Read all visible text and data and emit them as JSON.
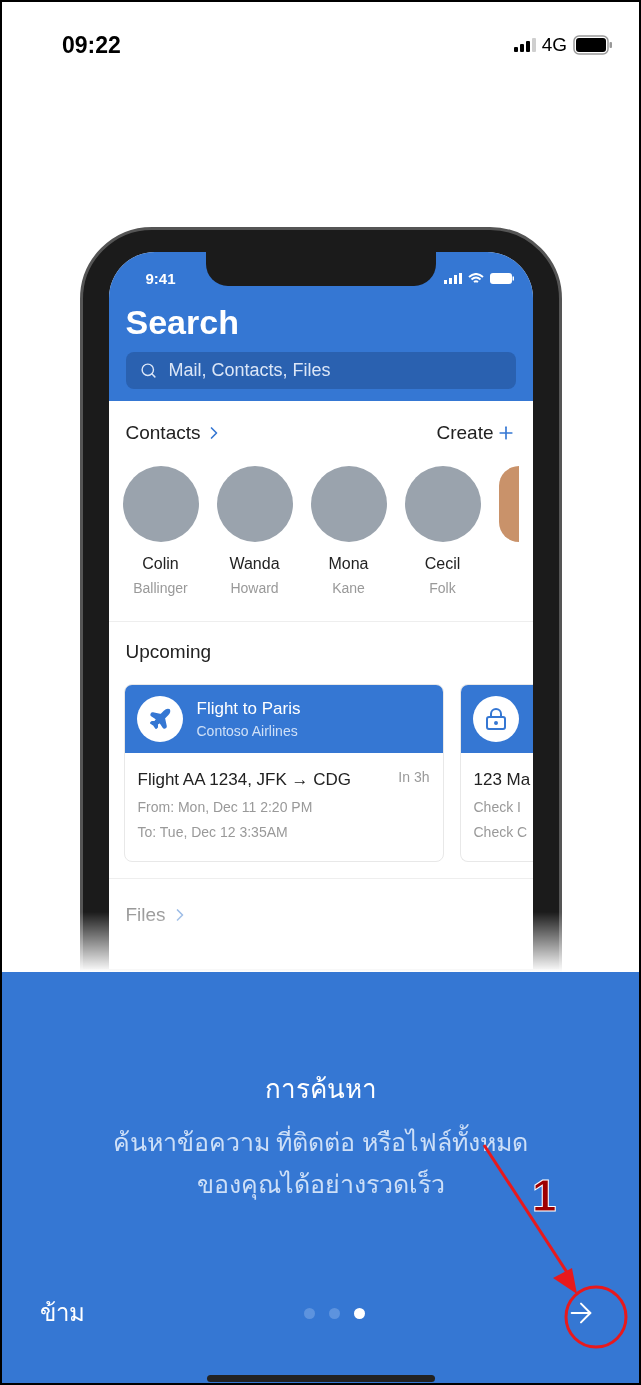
{
  "status_bar": {
    "time": "09:22",
    "network": "4G"
  },
  "mockup": {
    "time": "9:41",
    "title": "Search",
    "search": {
      "placeholder": "Mail, Contacts, Files"
    },
    "contacts": {
      "title": "Contacts",
      "action": "Create",
      "people": [
        {
          "first": "Colin",
          "last": "Ballinger"
        },
        {
          "first": "Wanda",
          "last": "Howard"
        },
        {
          "first": "Mona",
          "last": "Kane"
        },
        {
          "first": "Cecil",
          "last": "Folk"
        }
      ]
    },
    "upcoming": {
      "title": "Upcoming",
      "cards": [
        {
          "kind": "flight",
          "title": "Flight to Paris",
          "subtitle": "Contoso Airlines",
          "heading": "Flight AA 1234, JFK → CDG",
          "badge": "In 3h",
          "lines": [
            "From: Mon, Dec 11 2:20 PM",
            "To: Tue, Dec 12 3:35AM"
          ]
        },
        {
          "kind": "lodging",
          "heading": "123 Ma",
          "lines": [
            "Check I",
            "Check C"
          ]
        }
      ]
    },
    "files": {
      "title": "Files"
    }
  },
  "onboarding": {
    "title": "การค้นหา",
    "description": [
      "ค้นหาข้อความ ที่ติดต่อ หรือไฟล์ทั้งหมด",
      "ของคุณได้อย่างรวดเร็ว"
    ],
    "skip": "ข้าม",
    "dots": [
      {
        "selected": false
      },
      {
        "selected": false
      },
      {
        "selected": true
      }
    ]
  },
  "annotation": {
    "label": "1"
  }
}
